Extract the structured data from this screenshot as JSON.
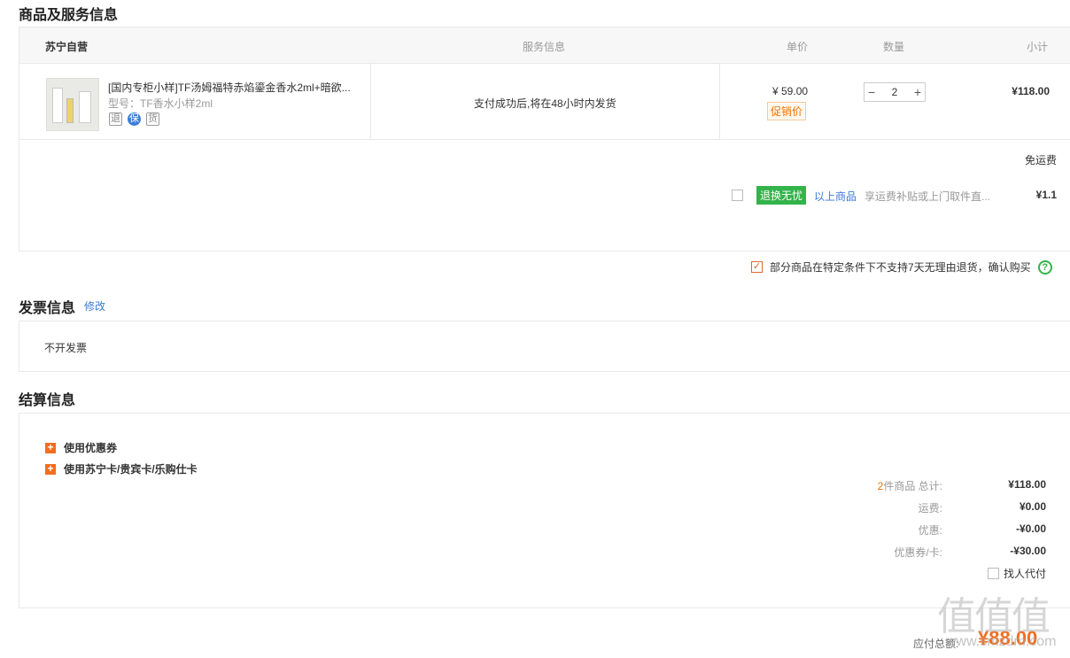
{
  "goods": {
    "section_title": "商品及服务信息",
    "headers": {
      "shop": "苏宁自营",
      "service": "服务信息",
      "price": "单价",
      "qty": "数量",
      "subtotal": "小计"
    },
    "item": {
      "name": "[国内专柜小样]TF汤姆福特赤焰鎏金香水2ml+暗欲...",
      "model": "型号：TF香水小样2ml",
      "icons": [
        "退",
        "保",
        "货"
      ],
      "service": "支付成功后,将在48小时内发货",
      "price": "¥ 59.00",
      "promo": "促销价",
      "qty": "2",
      "subtotal": "¥118.00"
    },
    "shipping": "免运费",
    "insurance": {
      "badge": "退换无忧",
      "link": "以上商品",
      "desc": "享运费补贴或上门取件直...",
      "price": "¥1.1"
    },
    "agree_text": "部分商品在特定条件下不支持7天无理由退货，确认购买"
  },
  "invoice": {
    "section_title": "发票信息",
    "edit": "修改",
    "value": "不开发票"
  },
  "settle": {
    "section_title": "结算信息",
    "coupon": "使用优惠券",
    "cards": "使用苏宁卡/贵宾卡/乐购仕卡",
    "count": "2",
    "total_label": "件商品 总计:",
    "total": "¥118.00",
    "freight_label": "运费:",
    "freight": "¥0.00",
    "discount_label": "优惠:",
    "discount": "-¥0.00",
    "coupon_label": "优惠券/卡:",
    "coupon_val": "-¥30.00",
    "pay_for": "找人代付",
    "payable_label": "应付总额:",
    "payable": "¥88.00"
  },
  "watermark": {
    "logo": "值值值",
    "sub": "www.smzdm.com"
  }
}
